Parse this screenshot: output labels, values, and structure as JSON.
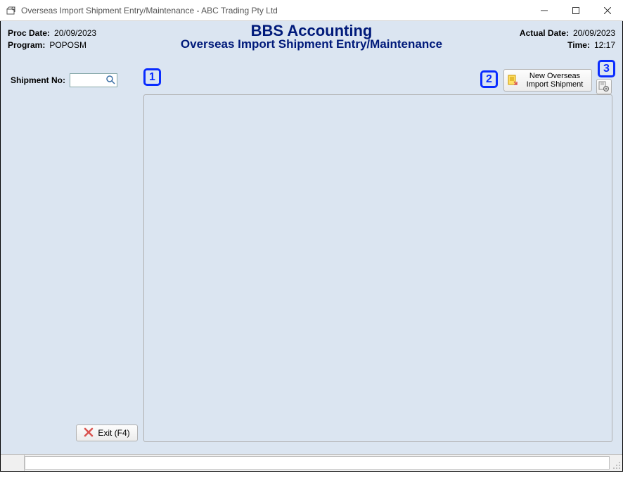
{
  "window": {
    "title": "Overseas Import Shipment Entry/Maintenance - ABC Trading Pty Ltd"
  },
  "header": {
    "proc_date_label": "Proc Date:",
    "proc_date_value": "20/09/2023",
    "program_label": "Program:",
    "program_value": "POPOSM",
    "actual_date_label": "Actual Date:",
    "actual_date_value": "20/09/2023",
    "time_label": "Time:",
    "time_value": "12:17",
    "title": "BBS Accounting",
    "subtitle": "Overseas Import Shipment Entry/Maintenance"
  },
  "shipment": {
    "label": "Shipment No:",
    "value": ""
  },
  "buttons": {
    "new_overseas_line1": "New Overseas",
    "new_overseas_line2": "Import Shipment",
    "exit_label": "Exit (F4)"
  },
  "callouts": {
    "c1": "1",
    "c2": "2",
    "c3": "3"
  }
}
